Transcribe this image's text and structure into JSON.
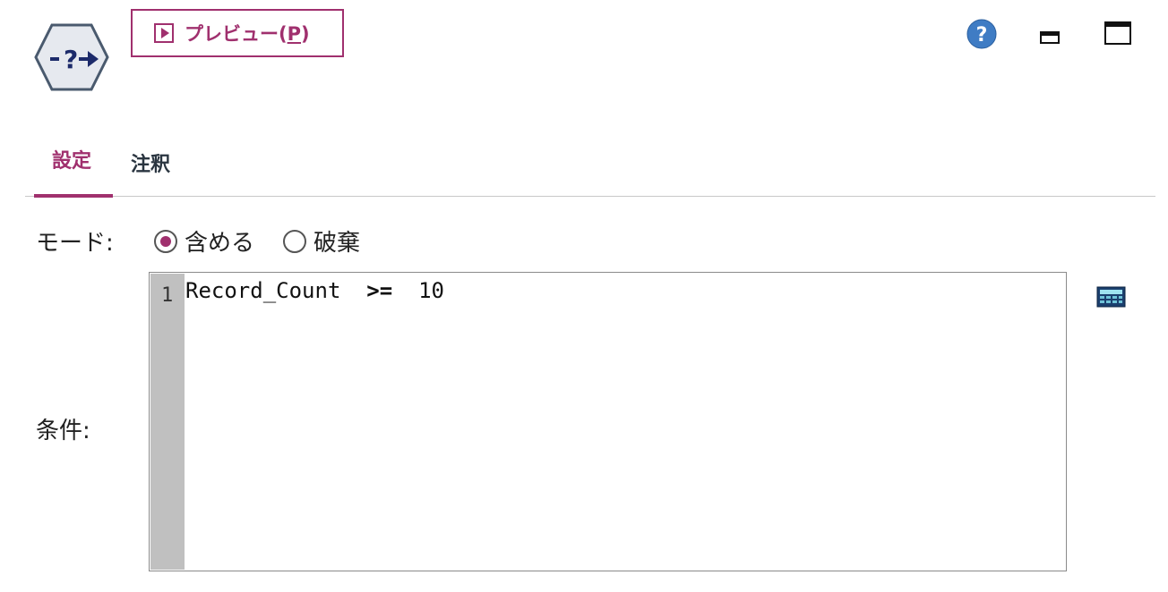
{
  "toolbar": {
    "preview_label": "プレビュー(",
    "preview_mnemonic": "P",
    "preview_suffix": ")",
    "icons": [
      "node-select-icon",
      "play-icon",
      "help-icon",
      "minimize-icon",
      "maximize-icon"
    ]
  },
  "tabs": [
    {
      "label": "設定",
      "active": true
    },
    {
      "label": "注釈",
      "active": false
    }
  ],
  "form": {
    "mode_label": "モード:",
    "mode_options": [
      {
        "label": "含める",
        "selected": true
      },
      {
        "label": "破棄",
        "selected": false
      }
    ],
    "condition_label": "条件:",
    "line_number": "1",
    "expression": {
      "field": "Record_Count",
      "operator": ">=",
      "value": "10"
    }
  },
  "colors": {
    "accent": "#a0306e",
    "help": "#3f7cc4",
    "gutter": "#c0c0c0"
  }
}
